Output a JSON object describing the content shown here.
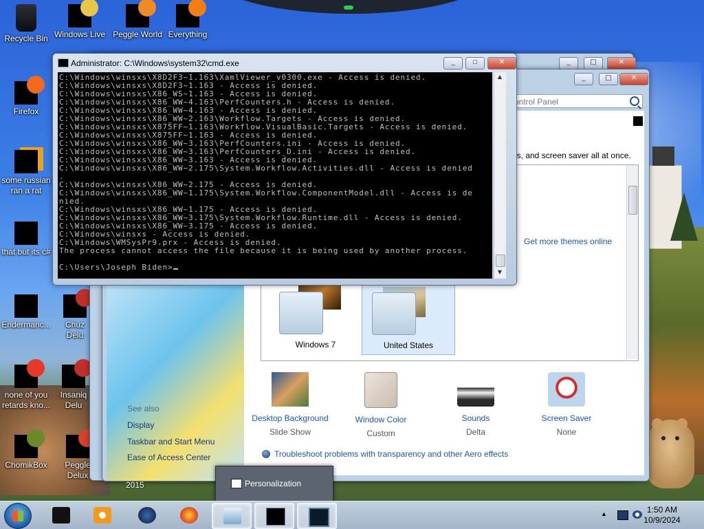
{
  "desktop": {
    "icons": [
      {
        "label": "Recycle Bin"
      },
      {
        "label": "Windows Live"
      },
      {
        "label": "Peggle World"
      },
      {
        "label": "Everything"
      },
      {
        "label": "Firefox"
      },
      {
        "label": "some russian ran a rat"
      },
      {
        "label": "that but its c#"
      },
      {
        "label": "Endermanc..."
      },
      {
        "label": "Chuz Delu"
      },
      {
        "label": "none of you retards kno..."
      },
      {
        "label": "Insaniq Delu"
      },
      {
        "label": "ChomikBox"
      },
      {
        "label": "Peggle Delux"
      }
    ]
  },
  "cmd": {
    "title": "Administrator: C:\\Windows\\system32\\cmd.exe",
    "lines": [
      "C:\\Windows\\winsxs\\X8D2F3~1.163\\XamlViewer_v0300.exe - Access is denied.",
      "C:\\Windows\\winsxs\\X8D2F3~1.163 - Access is denied.",
      "C:\\Windows\\winsxs\\X86_WS~1.163 - Access is denied.",
      "C:\\Windows\\winsxs\\X86_WW~4.163\\PerfCounters.h - Access is denied.",
      "C:\\Windows\\winsxs\\X86_WW~4.163 - Access is denied.",
      "C:\\Windows\\winsxs\\X86_WW~2.163\\Workflow.Targets - Access is denied.",
      "C:\\Windows\\winsxs\\X875FF~1.163\\Workflow.VisualBasic.Targets - Access is denied.",
      "C:\\Windows\\winsxs\\X875FF~1.163 - Access is denied.",
      "C:\\Windows\\winsxs\\X86_WW~3.163\\PerfCounters.ini - Access is denied.",
      "C:\\Windows\\winsxs\\X86_WW~3.163\\PerfCounters_D.ini - Access is denied.",
      "C:\\Windows\\winsxs\\X86_WW~3.163 - Access is denied.",
      "C:\\Windows\\winsxs\\X86_WW~2.175\\System.Workflow.Activities.dll - Access is denied",
      ".",
      "C:\\Windows\\winsxs\\X86_WW~2.175 - Access is denied.",
      "C:\\Windows\\winsxs\\X86_WW~1.175\\System.Workflow.ComponentModel.dll - Access is de",
      "nied.",
      "C:\\Windows\\winsxs\\X86_WW~1.175 - Access is denied.",
      "C:\\Windows\\winsxs\\X86_WW~3.175\\System.Workflow.Runtime.dll - Access is denied.",
      "C:\\Windows\\winsxs\\X86_WW~3.175 - Access is denied.",
      "C:\\Windows\\winsxs - Access is denied.",
      "C:\\Windows\\WMSysPr9.prx - Access is denied.",
      "The process cannot access the file because it is being used by another process.",
      "",
      "C:\\Users\\Joseph Biden>"
    ]
  },
  "personalization": {
    "search_placeholder": "ontrol Panel",
    "description": "ls, and screen saver all at once.",
    "get_more_themes": "Get more themes online",
    "themes": [
      {
        "name": "Windows 7"
      },
      {
        "name": "United States"
      }
    ],
    "see_also": "See also",
    "links": [
      "Display",
      "Taskbar and Start Menu",
      "Ease of Access Center"
    ],
    "year_text": "2015",
    "options": [
      {
        "title": "Desktop Background",
        "sub": "Slide Show"
      },
      {
        "title": "Window Color",
        "sub": "Custom"
      },
      {
        "title": "Sounds",
        "sub": "Delta"
      },
      {
        "title": "Screen Saver",
        "sub": "None"
      }
    ],
    "troubleshoot": "Troubleshoot problems with transparency and other Aero effects"
  },
  "preview": {
    "title": "Personalization"
  },
  "taskbar": {
    "time": "1:50 AM",
    "date": "10/9/2024"
  },
  "colors": {
    "console_bg": "#000000",
    "console_fg": "#c0c0c0",
    "link": "#1a56b0"
  }
}
